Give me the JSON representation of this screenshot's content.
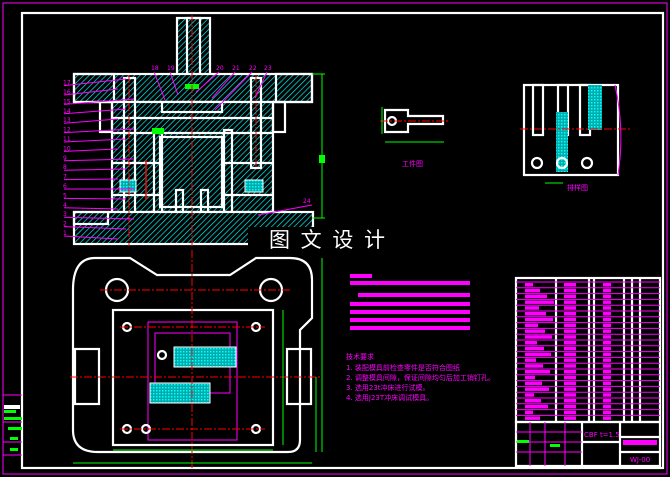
{
  "drawing": {
    "watermark": "图 文 设 计",
    "main_view_part_numbers_left": [
      "1",
      "2",
      "3",
      "4",
      "5",
      "6",
      "7",
      "8",
      "9",
      "10",
      "11",
      "12",
      "13",
      "14",
      "15",
      "16",
      "17"
    ],
    "main_view_part_numbers_top": [
      "18",
      "19",
      "20",
      "21",
      "22",
      "23"
    ],
    "part_number_24": "24",
    "workpiece_view_label": "工件图",
    "strip_layout_label": "排样图",
    "technical_requirements": {
      "title": "技术要求",
      "items": [
        "1. 装配模具前检查零件是否符合图纸",
        "2. 调整模具间隙，保证间隙均匀后加工销钉孔。",
        "3. 选用23t冲床进行试模。",
        "4. 选用J23T冲床调试模具。"
      ]
    },
    "title_block": {
      "material_thickness": "CBF  t=1.5",
      "drawing_number": "WJ-00"
    }
  },
  "colors": {
    "background": "#000000",
    "outline": "#ffffff",
    "hatch": "#00ffff",
    "centerline": "#ff0000",
    "dimension": "#00ff00",
    "text": "#ff00ff"
  }
}
